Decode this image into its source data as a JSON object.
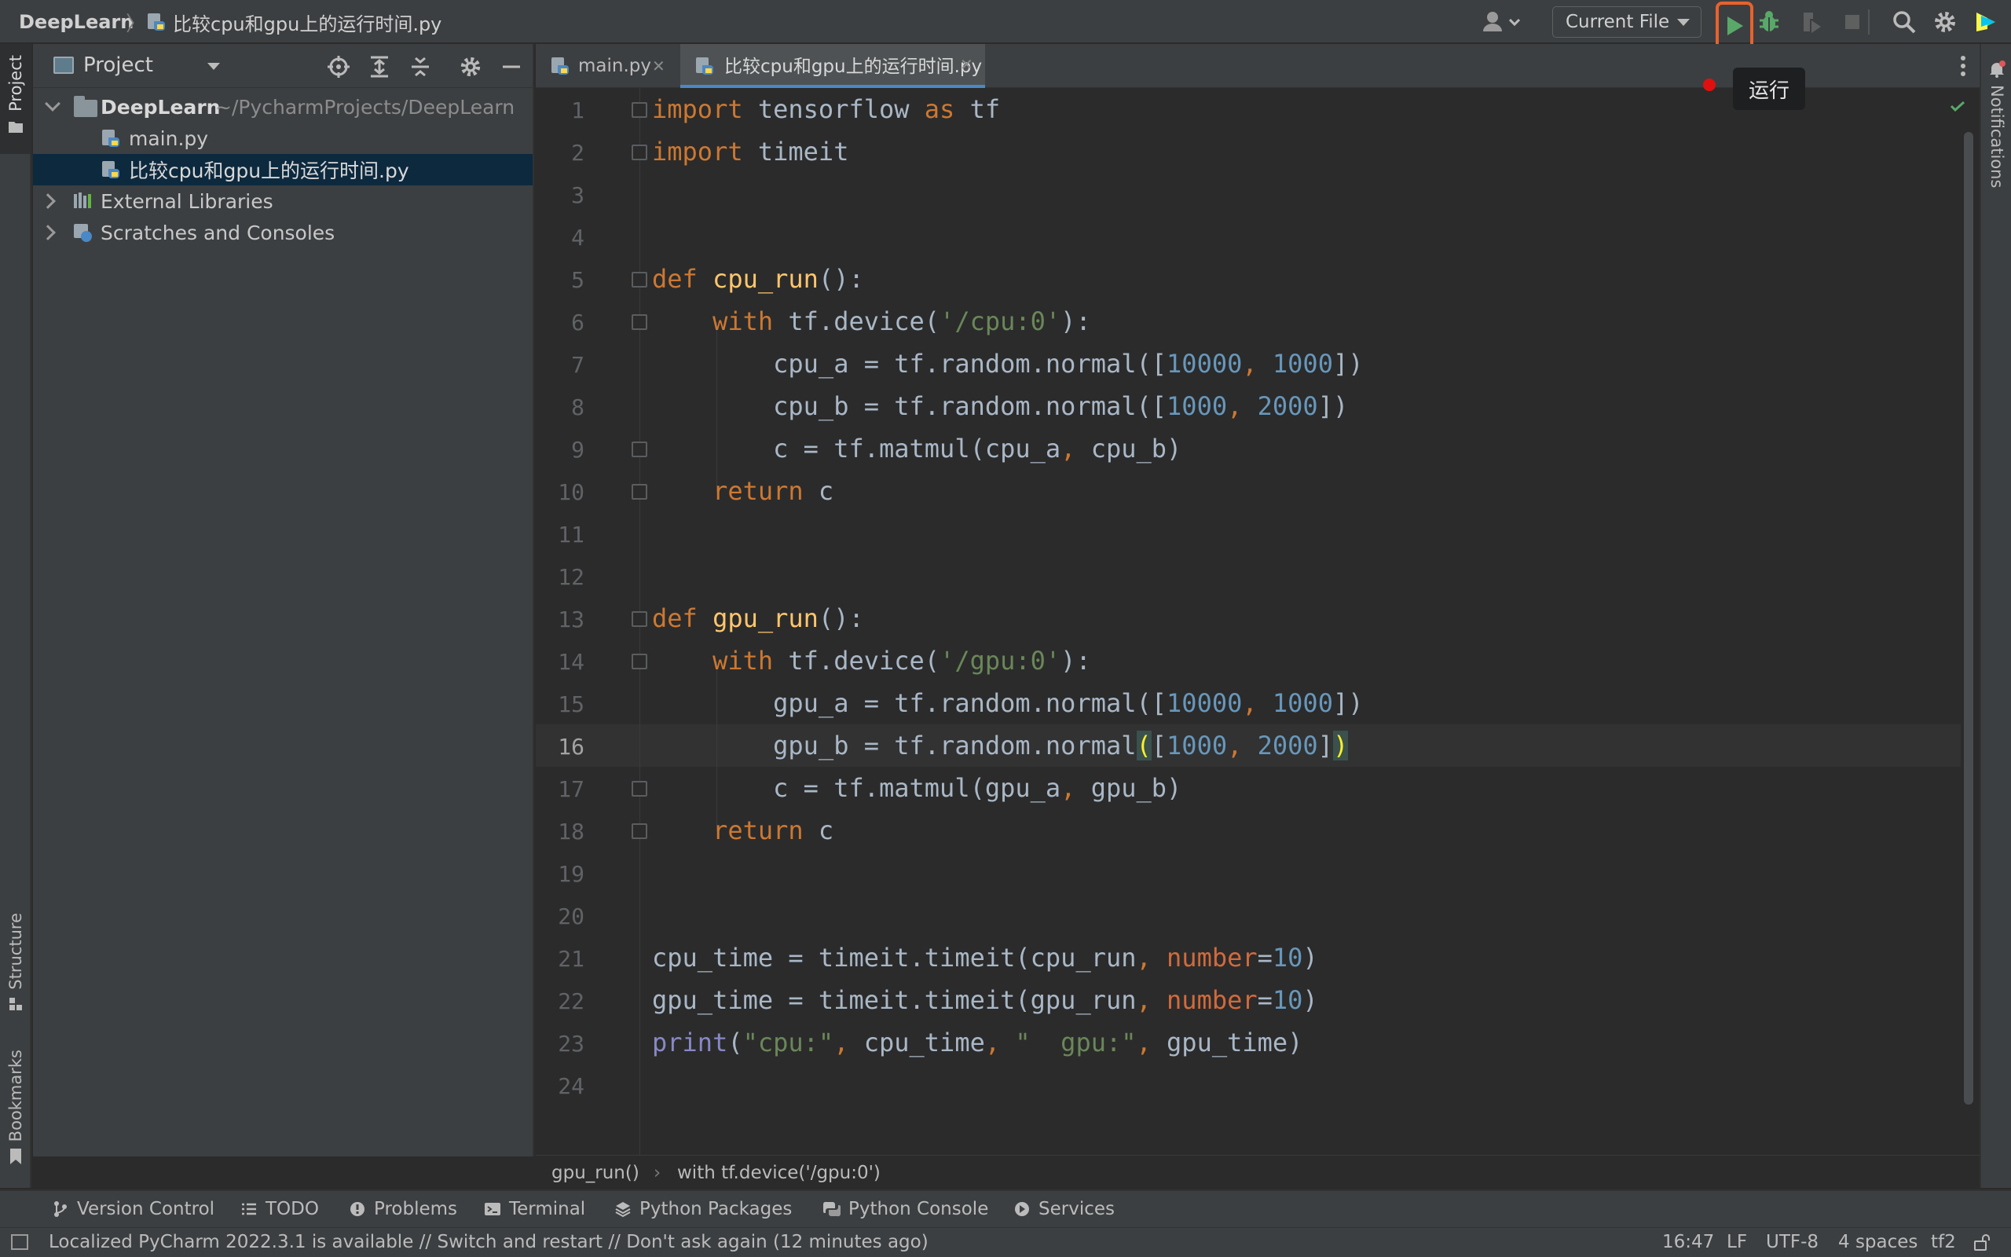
{
  "titlebar": {
    "project": "DeepLearn",
    "separator": "〉",
    "file": "比较cpu和gpu上的运行时间.py",
    "run_config": "Current File",
    "run_tooltip": "运行",
    "accent_color": "#e8622c"
  },
  "left_strip": {
    "project_tab": "Project",
    "structure_tab": "Structure",
    "bookmarks_tab": "Bookmarks"
  },
  "right_strip": {
    "notifications_tab": "Notifications"
  },
  "project_panel": {
    "title": "Project",
    "tree": [
      {
        "label": "DeepLearn",
        "path": "~/PycharmProjects/DeepLearn"
      },
      {
        "label": "main.py"
      },
      {
        "label": "比较cpu和gpu上的运行时间.py"
      },
      {
        "label": "External Libraries"
      },
      {
        "label": "Scratches and Consoles"
      }
    ]
  },
  "editor": {
    "tabs": [
      {
        "label": "main.py",
        "close": "✕"
      },
      {
        "label": "比较cpu和gpu上的运行时间.py",
        "close": "✕"
      }
    ],
    "current_line": 16,
    "line_numbers": [
      "1",
      "2",
      "3",
      "4",
      "5",
      "6",
      "7",
      "8",
      "9",
      "10",
      "11",
      "12",
      "13",
      "14",
      "15",
      "16",
      "17",
      "18",
      "19",
      "20",
      "21",
      "22",
      "23",
      "24"
    ],
    "tokens": {
      "import": "import",
      "tensorflow": " tensorflow ",
      "as": "as",
      "tf": " tf",
      "timeit_mod": " timeit",
      "def": "def",
      "cpu_run": "cpu_run",
      "gpu_run": "gpu_run",
      "sig": "():",
      "with": "with",
      "tf_device": " tf.device(",
      "cpu_dev": "'/cpu:0'",
      "gpu_dev": "'/gpu:0'",
      "close_colon": "):",
      "cpu_a_assign": "cpu_a = tf.random.normal([",
      "cpu_b_assign": "cpu_b = tf.random.normal([",
      "gpu_a_assign": "gpu_a = tf.random.normal([",
      "gpu_b_assign": "gpu_b = tf.random.normal",
      "open_paren": "(",
      "open_bracket": "[",
      "close_paren_hl": ")",
      "n10000": "10000",
      "n1000": "1000",
      "n2000": "2000",
      "comma": ", ",
      "close_list": "])",
      "close_bracket": "]",
      "c_cpu": "c = tf.matmul(cpu_a",
      "cpu_b_close": " cpu_b)",
      "c_gpu": "c = tf.matmul(gpu_a",
      "gpu_b_close": " gpu_b)",
      "return": "return",
      "ret_c": " c",
      "cpu_time_assign": "cpu_time = timeit.timeit(cpu_run",
      "gpu_time_assign": "gpu_time = timeit.timeit(gpu_run",
      "number": "number",
      "eq10": "=",
      "n10": "10",
      "close": ")",
      "print": "print",
      "str_cpu": "\"cpu:\"",
      "cpu_time_arg": " cpu_time",
      "str_gpu": "\"  gpu:\"",
      "gpu_time_close": " gpu_time)"
    }
  },
  "breadcrumb": {
    "first": "gpu_run()",
    "separator": "›",
    "second": "with tf.device('/gpu:0')"
  },
  "tool_windows": [
    "Version Control",
    "TODO",
    "Problems",
    "Terminal",
    "Python Packages",
    "Python Console",
    "Services"
  ],
  "statusbar": {
    "message": "Localized PyCharm 2022.3.1 is available // Switch and restart // Don't ask again (12 minutes ago)",
    "position": "16:47",
    "line_sep": "LF",
    "encoding": "UTF-8",
    "indent": "4 spaces",
    "interpreter": "tf2"
  }
}
